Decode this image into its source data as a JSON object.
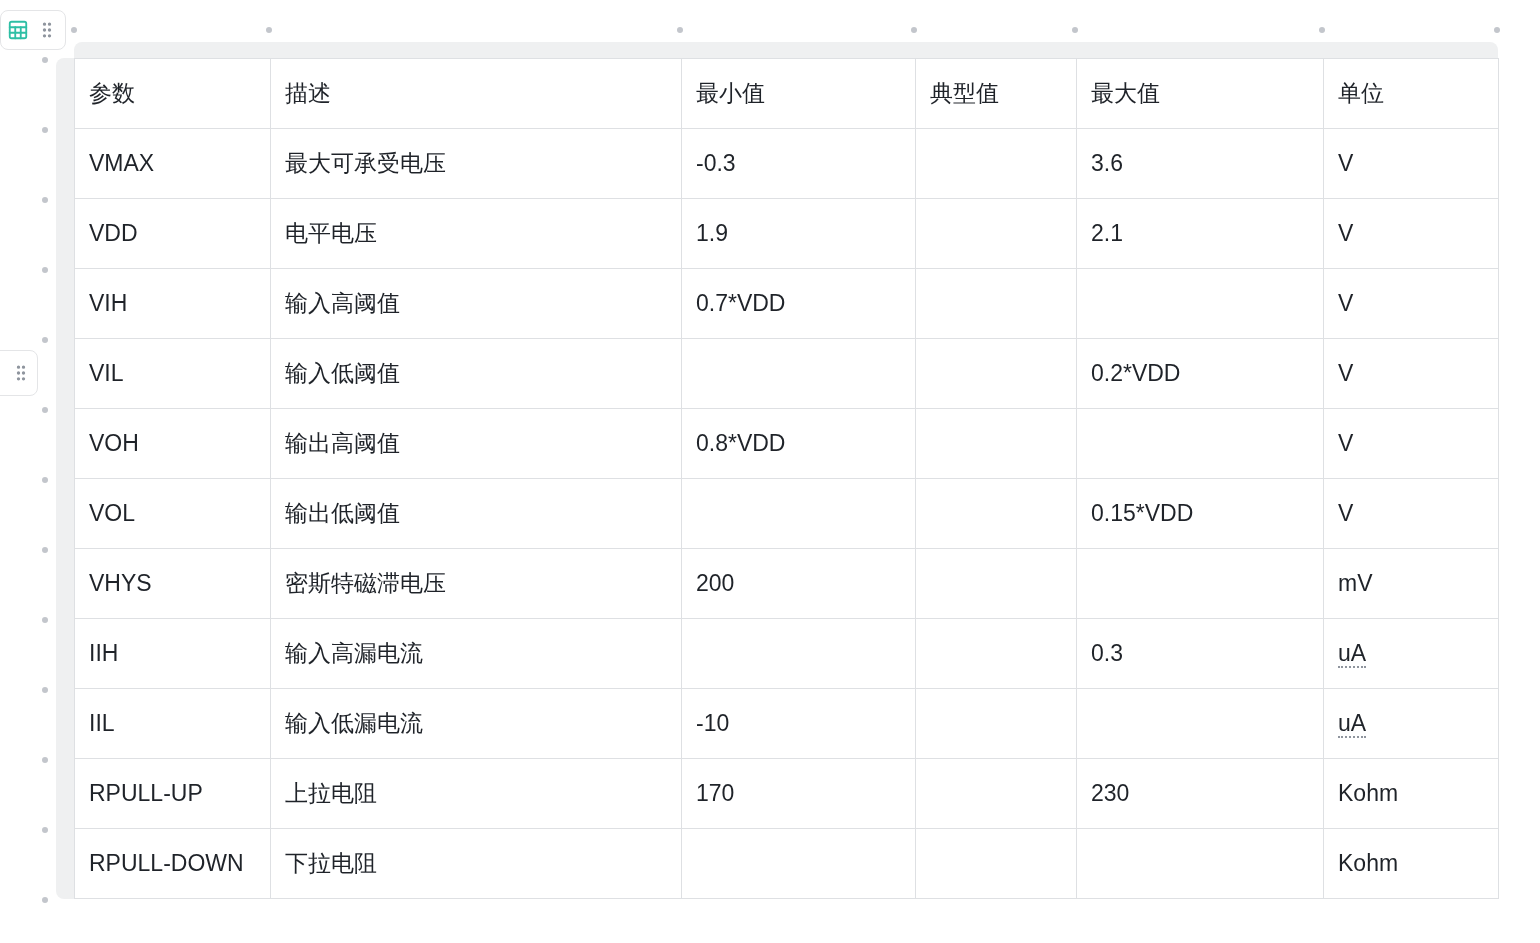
{
  "table": {
    "columns": [
      "参数",
      "描述",
      "最小值",
      "典型值",
      "最大值",
      "单位"
    ],
    "rows": [
      {
        "cells": [
          "VMAX",
          "最大可承受电压",
          "-0.3",
          "",
          "3.6",
          "V"
        ],
        "unit_flagged": false
      },
      {
        "cells": [
          "VDD",
          "电平电压",
          "1.9",
          "",
          "2.1",
          "V"
        ],
        "unit_flagged": false
      },
      {
        "cells": [
          "VIH",
          "输入高阈值",
          "0.7*VDD",
          "",
          "",
          "V"
        ],
        "unit_flagged": false
      },
      {
        "cells": [
          "VIL",
          "输入低阈值",
          "",
          "",
          "0.2*VDD",
          "V"
        ],
        "unit_flagged": false
      },
      {
        "cells": [
          "VOH",
          "输出高阈值",
          "0.8*VDD",
          "",
          "",
          "V"
        ],
        "unit_flagged": false
      },
      {
        "cells": [
          "VOL",
          "输出低阈值",
          "",
          "",
          "0.15*VDD",
          "V"
        ],
        "unit_flagged": false
      },
      {
        "cells": [
          "VHYS",
          "密斯特磁滞电压",
          "200",
          "",
          "",
          "mV"
        ],
        "unit_flagged": false
      },
      {
        "cells": [
          "IIH",
          "输入高漏电流",
          "",
          "",
          "0.3",
          "uA"
        ],
        "unit_flagged": true
      },
      {
        "cells": [
          "IIL",
          "输入低漏电流",
          "-10",
          "",
          "",
          "uA"
        ],
        "unit_flagged": true
      },
      {
        "cells": [
          "RPULL-UP",
          "上拉电阻",
          "170",
          "",
          "230",
          "Kohm"
        ],
        "unit_flagged": false
      },
      {
        "cells": [
          "RPULL-DOWN",
          "下拉电阻",
          "",
          "",
          "",
          "Kohm"
        ],
        "unit_flagged": false
      }
    ]
  }
}
